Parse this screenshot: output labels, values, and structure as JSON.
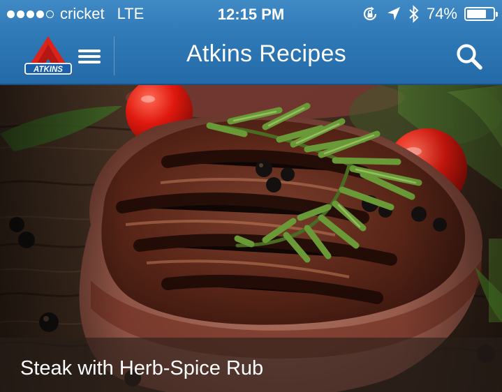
{
  "status_bar": {
    "carrier": "cricket",
    "network": "LTE",
    "time": "12:15 PM",
    "battery_percent": "74%",
    "battery_level": 0.74,
    "signal_bars_filled": 4,
    "signal_bars_total": 5
  },
  "nav": {
    "title": "Atkins Recipes",
    "logo_text": "ATKINS"
  },
  "hero": {
    "caption": "Steak with Herb-Spice Rub"
  },
  "colors": {
    "nav_blue": "#2f78b6",
    "logo_red": "#d9241c",
    "logo_blue": "#1b5fa8"
  },
  "icons": {
    "menu": "hamburger-icon",
    "search": "search-icon",
    "rotation_lock": "rotation-lock-icon",
    "location": "location-arrow-icon",
    "bluetooth": "bluetooth-icon",
    "battery": "battery-icon"
  }
}
